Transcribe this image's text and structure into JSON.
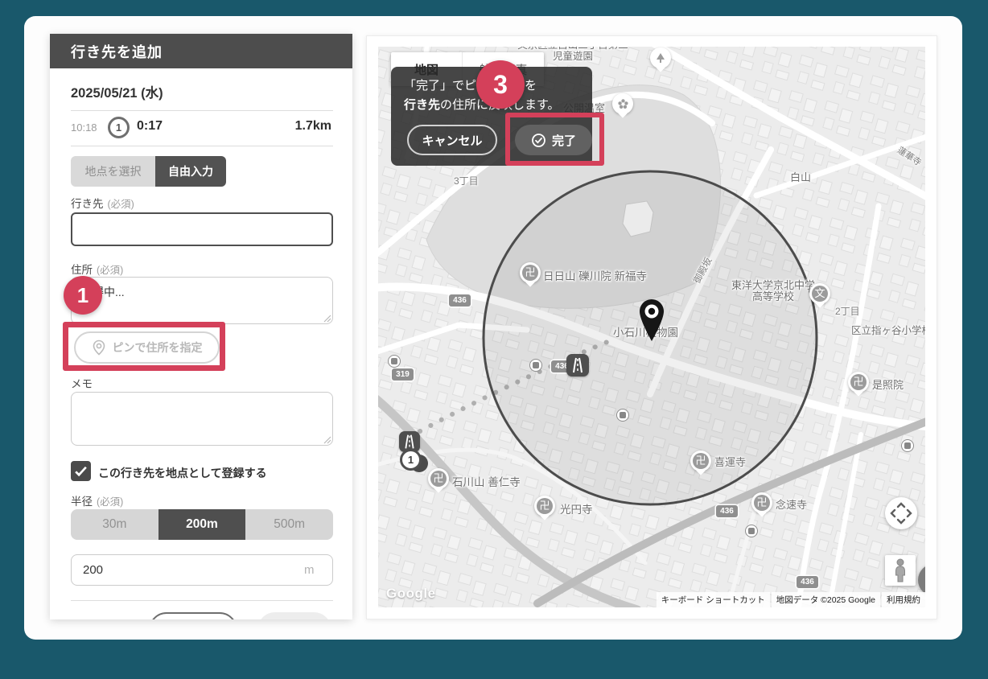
{
  "form": {
    "title": "行き先を追加",
    "date": "2025/05/21 (水)",
    "trip": {
      "time": "10:18",
      "seq": "1",
      "duration": "0:17",
      "distance": "1.7km"
    },
    "tabs": {
      "point": "地点を選択",
      "free": "自由入力"
    },
    "fields": {
      "destination_label": "行き先",
      "destination_required": "(必須)",
      "destination_value": "",
      "address_label": "住所",
      "address_required": "(必須)",
      "address_value": "取得中...",
      "pin_button": "ピンで住所を指定",
      "memo_label": "メモ",
      "memo_value": "",
      "register_label": "この行き先を地点として登録する",
      "radius_label": "半径",
      "radius_required": "(必須)",
      "radius_options": [
        "30m",
        "200m",
        "500m"
      ],
      "radius_selected": "200m",
      "radius_value": "200",
      "radius_unit": "m"
    }
  },
  "annotations": {
    "step1": "1",
    "step3": "3",
    "color": "#d4405a"
  },
  "map": {
    "controls": {
      "map_type": "地図",
      "satellite": "航空写真"
    },
    "tooltip": {
      "line1": "「完了」でピンの位置を",
      "line2_em": "行き先",
      "line2_rest": "の住所に反映します。",
      "cancel": "キャンセル",
      "done": "完了"
    },
    "icons": {
      "temple": "卍",
      "school": "文"
    },
    "marker1": "1",
    "badges": [
      "436",
      "319",
      "436",
      "436",
      "436"
    ],
    "pois": [
      {
        "name": "文京区立白山二丁目第二児童遊園"
      },
      {
        "name": "公開温室"
      },
      {
        "name": "3丁目"
      },
      {
        "name": "日日山 礫川院 新福寺"
      },
      {
        "name": "東洋大学京北中学高等学校"
      },
      {
        "name": "白山"
      },
      {
        "name": "蓮華寺"
      },
      {
        "name": "小石川植物園"
      },
      {
        "name": "2丁目"
      },
      {
        "name": "区立指ヶ谷小学校"
      },
      {
        "name": "是照院"
      },
      {
        "name": "石川山 善仁寺"
      },
      {
        "name": "光円寺"
      },
      {
        "name": "喜運寺"
      },
      {
        "name": "念速寺"
      },
      {
        "name": "御殿坂"
      }
    ],
    "logo": "Google",
    "attribution": [
      "キーボード ショートカット",
      "地図データ ©2025 Google",
      "利用規約"
    ]
  }
}
